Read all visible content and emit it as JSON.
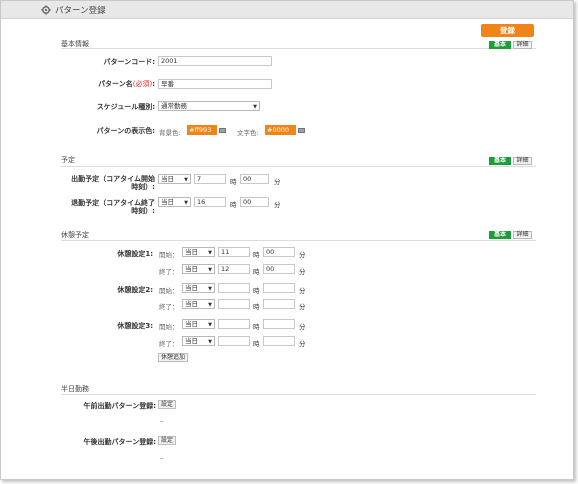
{
  "window": {
    "title": "パターン登録"
  },
  "toolbar": {
    "register_label": "登録"
  },
  "badges": {
    "basic": "基本",
    "detail": "詳細"
  },
  "basic_info": {
    "section": "基本情報",
    "pattern_code_label": "パターンコード:",
    "pattern_code_value": "2001",
    "pattern_name_label": "パターン名",
    "pattern_name_required": "(必須)",
    "pattern_name_colon": ":",
    "pattern_name_value": "早番",
    "schedule_type_label": "スケジュール種別:",
    "schedule_type_value": "通常勤務",
    "display_color_label": "パターンの表示色:",
    "bg_color_label": "背景色:",
    "bg_color_value": "#ff993",
    "text_color_label": "文字色:",
    "text_color_value": "#0000",
    "bg_color_hex": "#f08418"
  },
  "schedule": {
    "section": "予定",
    "start_label_1": "出勤予定（コアタイム開始",
    "start_label_2": "時刻）:",
    "start_day": "当日",
    "start_hour": "7",
    "start_minute": "00",
    "end_label_1": "退勤予定（コアタイム終了",
    "end_label_2": "時刻）:",
    "end_day": "当日",
    "end_hour": "16",
    "end_minute": "00",
    "hour_unit": "時",
    "minute_unit": "分"
  },
  "breaks": {
    "section": "休憩予定",
    "start_sub": "開始：",
    "end_sub": "終了：",
    "day_value": "当日",
    "hour_unit": "時",
    "minute_unit": "分",
    "b1_label": "休憩設定1:",
    "b1_start_hour": "11",
    "b1_start_minute": "00",
    "b1_end_hour": "12",
    "b1_end_minute": "00",
    "b2_label": "休憩設定2:",
    "b3_label": "休憩設定3:",
    "add_break_label": "休憩追加"
  },
  "half_day": {
    "section": "半日勤務",
    "am_label": "午前出勤パターン登録:",
    "pm_label": "午後出勤パターン登録:",
    "set_label": "設定",
    "empty_value": "–"
  }
}
